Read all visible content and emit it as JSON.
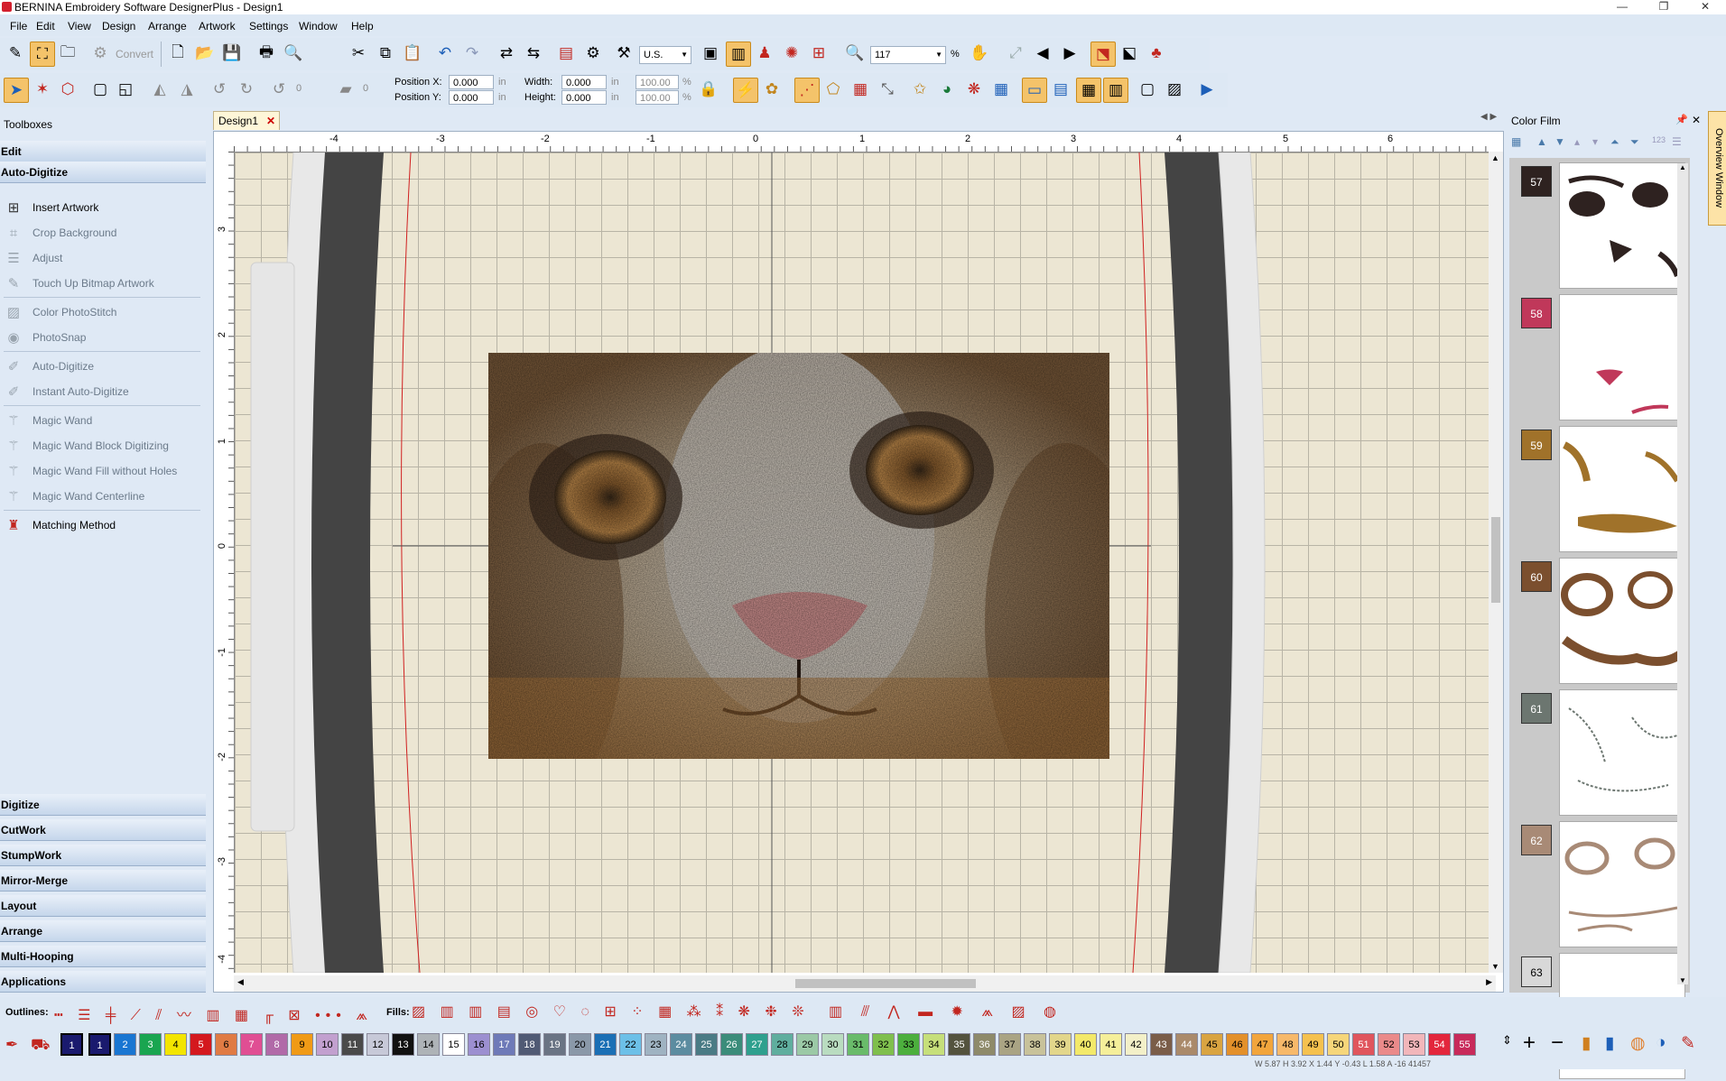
{
  "window": {
    "title": "BERNINA Embroidery Software DesignerPlus - Design1",
    "minimize": "—",
    "maximize": "❐",
    "close": "✕"
  },
  "menu": [
    "File",
    "Edit",
    "View",
    "Design",
    "Arrange",
    "Artwork",
    "Settings",
    "Window",
    "Help"
  ],
  "toolbar": {
    "convert_label": "Convert",
    "units": "U.S.",
    "zoom": "117",
    "zoom_unit": "%"
  },
  "properties": {
    "position_x_label": "Position X:",
    "position_x": "0.000",
    "position_y_label": "Position Y:",
    "position_y": "0.000",
    "width_label": "Width:",
    "width": "0.000",
    "height_label": "Height:",
    "height": "0.000",
    "unit": "in",
    "scale_w": "100.00",
    "scale_h": "100.00",
    "pct": "%",
    "rotate_value": "0",
    "slant_value": "0"
  },
  "toolboxes": {
    "title": "Toolboxes",
    "sections_top": [
      "Edit",
      "Auto-Digitize"
    ],
    "tools": [
      {
        "label": "Insert Artwork",
        "icon": "insert-artwork-icon",
        "enabled": true
      },
      {
        "label": "Crop Background",
        "icon": "crop-icon",
        "enabled": false
      },
      {
        "label": "Adjust",
        "icon": "adjust-icon",
        "enabled": false
      },
      {
        "label": "Touch Up Bitmap Artwork",
        "icon": "brush-icon",
        "enabled": false
      },
      {
        "label": "Color PhotoStitch",
        "icon": "photostitch-icon",
        "enabled": false
      },
      {
        "label": "PhotoSnap",
        "icon": "camera-icon",
        "enabled": false
      },
      {
        "label": "Auto-Digitize",
        "icon": "auto-digitize-icon",
        "enabled": false
      },
      {
        "label": "Instant Auto-Digitize",
        "icon": "instant-digitize-icon",
        "enabled": false
      },
      {
        "label": "Magic Wand",
        "icon": "magic-wand-icon",
        "enabled": false
      },
      {
        "label": "Magic Wand Block Digitizing",
        "icon": "magic-wand-block-icon",
        "enabled": false
      },
      {
        "label": "Magic Wand Fill without Holes",
        "icon": "magic-wand-fill-icon",
        "enabled": false
      },
      {
        "label": "Magic Wand Centerline",
        "icon": "magic-wand-centerline-icon",
        "enabled": false
      },
      {
        "label": "Matching Method",
        "icon": "matching-method-icon",
        "enabled": true
      }
    ],
    "sections_bottom": [
      "Digitize",
      "CutWork",
      "StumpWork",
      "Mirror-Merge",
      "Layout",
      "Arrange",
      "Multi-Hooping",
      "Applications"
    ]
  },
  "document": {
    "tab_label": "Design1",
    "tab_close": "✕"
  },
  "rulers": {
    "h": [
      "-4",
      "-3",
      "-2",
      "-1",
      "0",
      "1",
      "2",
      "3",
      "4",
      "5",
      "6"
    ],
    "v": [
      "3",
      "2",
      "1",
      "0",
      "-1",
      "-2",
      "-3",
      "-4"
    ]
  },
  "color_film": {
    "title": "Color Film",
    "overview_label": "Overview Window",
    "frames": [
      {
        "num": "57",
        "color": "#2e2220"
      },
      {
        "num": "58",
        "color": "#c0385a"
      },
      {
        "num": "59",
        "color": "#a0722a"
      },
      {
        "num": "60",
        "color": "#7b4f2e"
      },
      {
        "num": "61",
        "color": "#6c7670"
      },
      {
        "num": "62",
        "color": "#a88a76"
      },
      {
        "num": "63",
        "color": "#d8d8d8"
      }
    ]
  },
  "stitchbar": {
    "outlines_label": "Outlines:",
    "fills_label": "Fills:"
  },
  "palette": {
    "first_selected": "1",
    "swatches": [
      {
        "n": "1",
        "c": "#1a1a6e"
      },
      {
        "n": "2",
        "c": "#1976d2"
      },
      {
        "n": "3",
        "c": "#19a550"
      },
      {
        "n": "4",
        "c": "#f3e500"
      },
      {
        "n": "5",
        "c": "#d4181e"
      },
      {
        "n": "6",
        "c": "#e07b44"
      },
      {
        "n": "7",
        "c": "#e04e93"
      },
      {
        "n": "8",
        "c": "#b16aa8"
      },
      {
        "n": "9",
        "c": "#f09a16"
      },
      {
        "n": "10",
        "c": "#c2a0cf"
      },
      {
        "n": "11",
        "c": "#4a4a4a"
      },
      {
        "n": "12",
        "c": "#c7c9d8"
      },
      {
        "n": "13",
        "c": "#111111"
      },
      {
        "n": "14",
        "c": "#aeb3b7"
      },
      {
        "n": "15",
        "c": "#ffffff"
      },
      {
        "n": "16",
        "c": "#9c8fd0"
      },
      {
        "n": "17",
        "c": "#6e7ab8"
      },
      {
        "n": "18",
        "c": "#505a74"
      },
      {
        "n": "19",
        "c": "#6a7484"
      },
      {
        "n": "20",
        "c": "#8a98a8"
      },
      {
        "n": "21",
        "c": "#1a6fb5"
      },
      {
        "n": "22",
        "c": "#6cc0e8"
      },
      {
        "n": "23",
        "c": "#9fb3c2"
      },
      {
        "n": "24",
        "c": "#5c8ca0"
      },
      {
        "n": "25",
        "c": "#4a7b85"
      },
      {
        "n": "26",
        "c": "#3b8c7a"
      },
      {
        "n": "27",
        "c": "#2ea08e"
      },
      {
        "n": "28",
        "c": "#5fae9e"
      },
      {
        "n": "29",
        "c": "#9bc9a6"
      },
      {
        "n": "30",
        "c": "#b9dcc0"
      },
      {
        "n": "31",
        "c": "#69bb6a"
      },
      {
        "n": "32",
        "c": "#7fbf4d"
      },
      {
        "n": "33",
        "c": "#4caf3d"
      },
      {
        "n": "34",
        "c": "#c6df7a"
      },
      {
        "n": "35",
        "c": "#54533e"
      },
      {
        "n": "36",
        "c": "#8e8a6a"
      },
      {
        "n": "37",
        "c": "#aaa484"
      },
      {
        "n": "38",
        "c": "#c8c29a"
      },
      {
        "n": "39",
        "c": "#e2d68b"
      },
      {
        "n": "40",
        "c": "#f3e96a"
      },
      {
        "n": "41",
        "c": "#f5ef9a"
      },
      {
        "n": "42",
        "c": "#f3f0c8"
      },
      {
        "n": "43",
        "c": "#7a5d48"
      },
      {
        "n": "44",
        "c": "#aa8a6a"
      },
      {
        "n": "45",
        "c": "#d9a441"
      },
      {
        "n": "46",
        "c": "#e3902a"
      },
      {
        "n": "47",
        "c": "#f2a53c"
      },
      {
        "n": "48",
        "c": "#f7b96a"
      },
      {
        "n": "49",
        "c": "#f5c14e"
      },
      {
        "n": "50",
        "c": "#f6d67a"
      },
      {
        "n": "51",
        "c": "#e0555d"
      },
      {
        "n": "52",
        "c": "#ea8a8a"
      },
      {
        "n": "53",
        "c": "#f2b6ba"
      },
      {
        "n": "54",
        "c": "#e3263c"
      },
      {
        "n": "55",
        "c": "#c82a5a"
      }
    ]
  },
  "status": {
    "text": "W 5.87  H 3.92      X 1.44  Y -0.43  L 1.58  A -16      41457"
  }
}
